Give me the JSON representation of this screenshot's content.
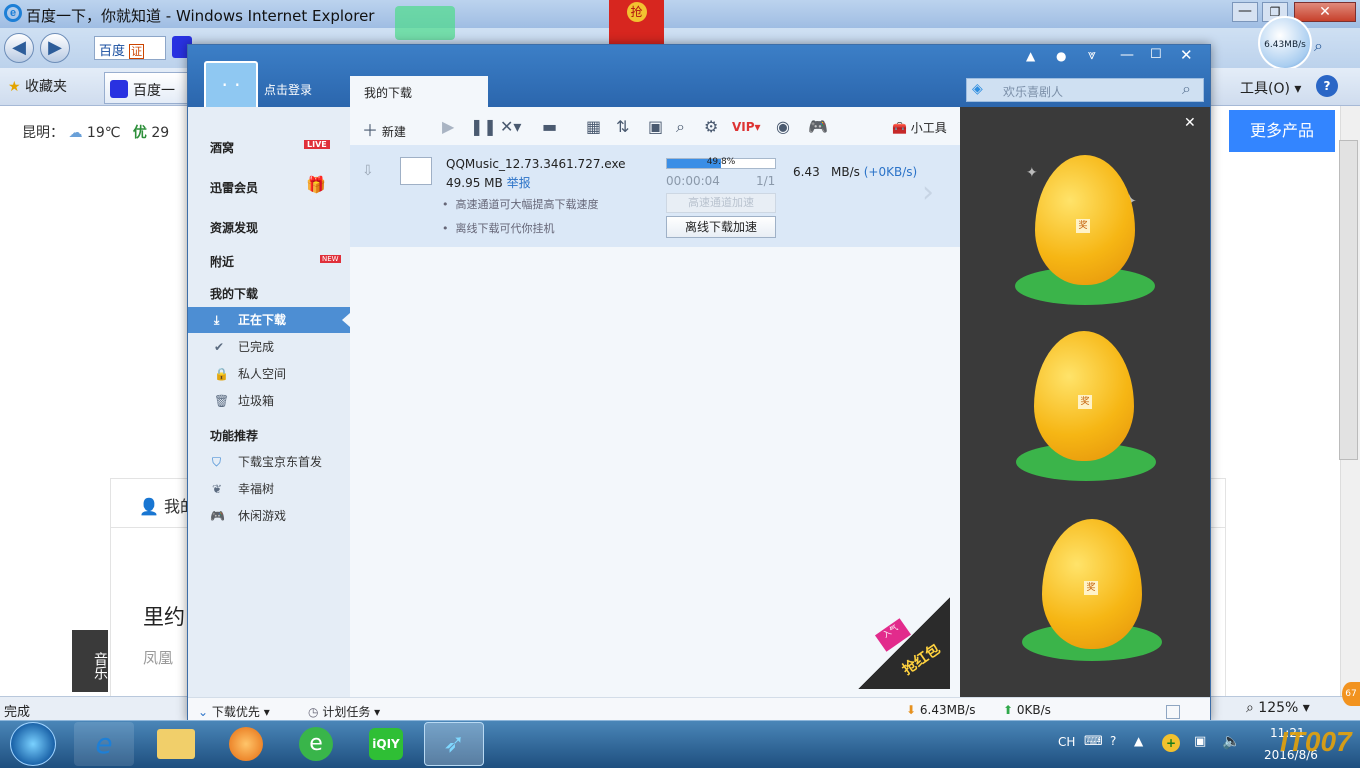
{
  "browser": {
    "title": "百度一下，你就知道 - Windows Internet Explorer",
    "search_bar_label": "百度",
    "search_bar_button": "证",
    "favorites_label": "收藏夹",
    "tab_label": "百度一下",
    "tools_label": "工具(O)",
    "help_label": "?",
    "status_text": "完成",
    "zoom_text": "125%",
    "speed_bubble": "6.43MB/s"
  },
  "page": {
    "weather_city": "昆明：",
    "weather_temp": "19℃",
    "weather_quality": "优",
    "weather_aqi": "29",
    "more_products": "更多产品",
    "login_hint": "我的",
    "article_title": "里约",
    "article_sub": "凤凰",
    "music_tab": "音乐"
  },
  "redpacket_top": "抢",
  "thunder": {
    "login_text": "点击登录",
    "tab_my_downloads": "我的下载",
    "search_placeholder": "欢乐喜剧人",
    "toolbar": {
      "new_label": "新建",
      "tools_label": "小工具"
    },
    "sidebar": {
      "items_top": [
        {
          "label": "酒窝",
          "badge": "LIVE"
        },
        {
          "label": "迅雷会员",
          "badge": ""
        },
        {
          "label": "资源发现",
          "badge": ""
        },
        {
          "label": "附近",
          "badge": "NEW"
        }
      ],
      "section_downloads": "我的下载",
      "downloads": [
        {
          "label": "正在下载"
        },
        {
          "label": "已完成"
        },
        {
          "label": "私人空间"
        },
        {
          "label": "垃圾箱"
        }
      ],
      "section_features": "功能推荐",
      "features": [
        {
          "label": "下载宝京东首发"
        },
        {
          "label": "幸福树"
        },
        {
          "label": "休闲游戏"
        }
      ]
    },
    "task": {
      "filename": "QQMusic_12.73.3461.727.exe",
      "size": "49.95 MB",
      "report": "举报",
      "progress_text": "49.8%",
      "progress": 0.498,
      "elapsed": "00:00:04",
      "pieces": "1/1",
      "speed_value": "6.43",
      "speed_unit": "MB/s",
      "speed_extra": "(+0KB/s)",
      "tip1": "高速通道可大幅提高下载速度",
      "tip2": "离线下载可代你挂机",
      "btn_high_speed": "高速通道加速",
      "btn_offline": "离线下载加速"
    },
    "ad": {
      "egg_tag": "奖",
      "corner_top": "入气",
      "corner_main": "抢红包"
    },
    "footer": {
      "priority": "下载优先",
      "schedule": "计划任务",
      "down_speed": "6.43MB/s",
      "up_speed": "0KB/s"
    }
  },
  "taskbar": {
    "ime": "CH",
    "time": "11:21",
    "date": "2016/8/6",
    "watermark": "IT007",
    "notif_count": "67"
  }
}
